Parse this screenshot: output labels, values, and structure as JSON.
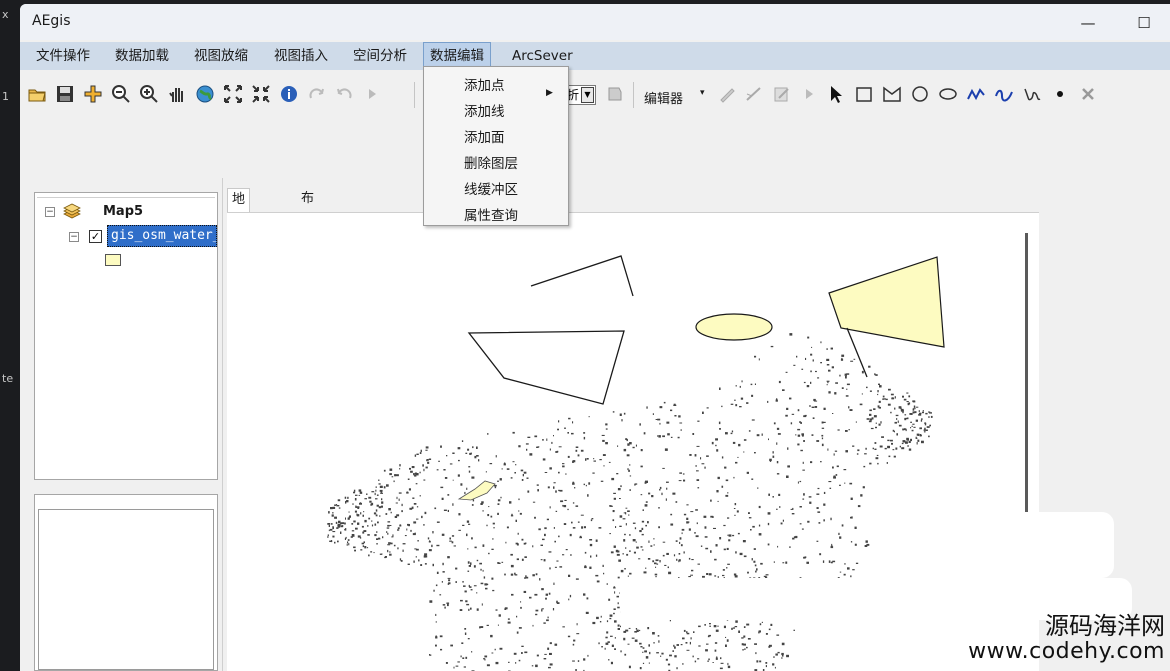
{
  "window": {
    "title": "AEgis",
    "minimize_glyph": "—",
    "maximize_glyph": "☐"
  },
  "left_strip": {
    "fragments": [
      "x",
      "1",
      "te"
    ]
  },
  "menu": {
    "items": [
      "文件操作",
      "数据加载",
      "视图放缩",
      "视图插入",
      "空间分析",
      "数据编辑",
      "ArcSever"
    ],
    "active_index": 5
  },
  "toolbar": {
    "icons": [
      "open-folder-icon",
      "save-icon",
      "add-data-icon",
      "zoom-out-icon",
      "zoom-in-icon",
      "pan-hand-icon",
      "full-extent-globe-icon",
      "fixed-zoom-in-icon",
      "fixed-zoom-out-icon",
      "identify-icon",
      "redo-icon",
      "undo-icon",
      "arrow-icon"
    ],
    "combo_value": "折",
    "editor_label": "编辑器",
    "editor_drop_glyph": "▾",
    "sketch_tools": [
      "pencil-icon",
      "line-icon",
      "edit-icon",
      "arrow-icon",
      "select-pointer-icon",
      "rectangle-icon",
      "polygon-icon",
      "circle-icon",
      "ellipse-icon",
      "polyline-icon",
      "curve-icon",
      "freehand-icon",
      "point-icon",
      "delete-icon"
    ]
  },
  "toc": {
    "map_name": "Map5",
    "layer_name": "gis_osm_water_",
    "expander_glyph": "−",
    "checkbox_glyph": "✓",
    "legend_fill": "#fdfbc1"
  },
  "map": {
    "tabs": [
      "地图视图",
      "布局视图"
    ],
    "active_tab": 0,
    "polygon_fill": "#fdfbc1",
    "outline_color": "#1a1a1a",
    "dots_color": "#444444"
  },
  "dropdown": {
    "items": [
      "添加点",
      "添加线",
      "添加面",
      "删除图层",
      "线缓冲区",
      "属性查询"
    ],
    "submenu_glyph": "▶"
  },
  "watermark": {
    "name": "源码海洋网",
    "url": "www.codehy.com"
  }
}
